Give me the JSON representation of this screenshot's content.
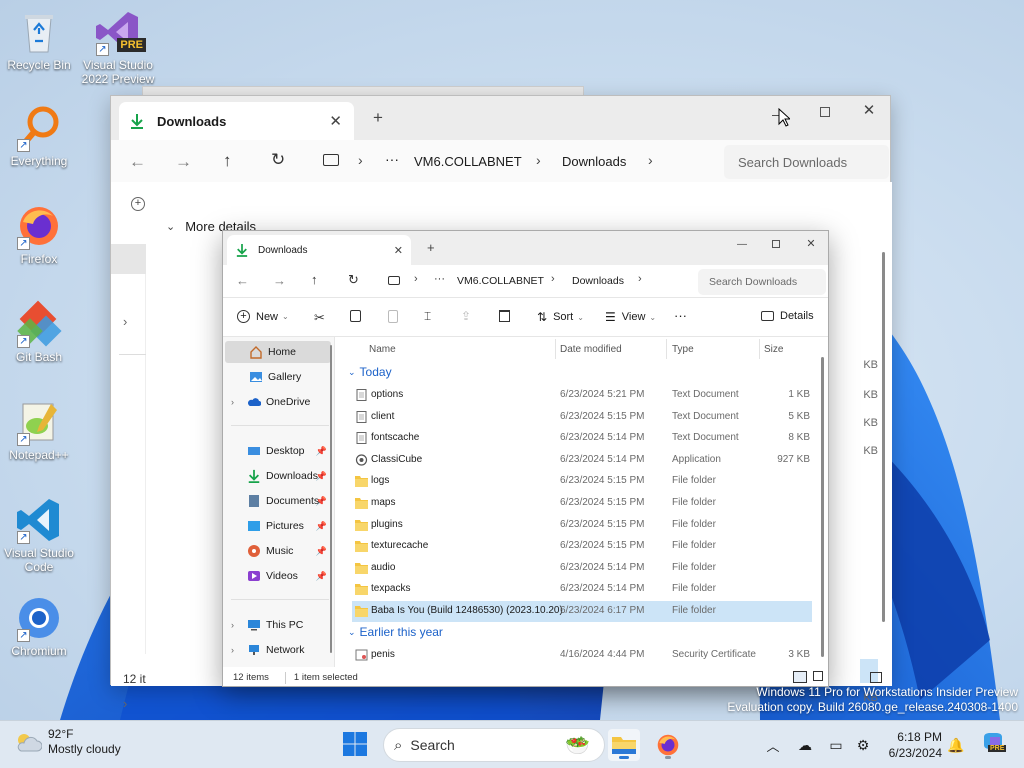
{
  "desktop": {
    "icons": [
      {
        "label": "Recycle Bin"
      },
      {
        "label": "Visual Studio 2022 Preview",
        "badge": "PRE"
      },
      {
        "label": "Everything"
      },
      {
        "label": "Firefox"
      },
      {
        "label": "Git Bash"
      },
      {
        "label": "Notepad++"
      },
      {
        "label": "Visual Studio Code"
      },
      {
        "label": "Chromium"
      }
    ]
  },
  "back_window": {
    "tab_label": "Downloads",
    "new_tab": "+",
    "breadcrumb": {
      "more": "···",
      "items": [
        "VM6.COLLABNET",
        "Downloads"
      ]
    },
    "search_placeholder": "Search Downloads",
    "details_bar_label": "More details",
    "status_count": "12 it",
    "right_sizes": [
      "KB",
      "KB",
      "KB",
      "KB",
      "KB"
    ]
  },
  "front_window": {
    "tab_label": "Downloads",
    "new_tab": "+",
    "breadcrumb": {
      "more": "···",
      "items": [
        "VM6.COLLABNET",
        "Downloads"
      ]
    },
    "search_placeholder": "Search Downloads",
    "toolbar": {
      "new_label": "New",
      "sort_label": "Sort",
      "view_label": "View",
      "more_label": "···",
      "details_label": "Details"
    },
    "sidebar": {
      "top": [
        "Home",
        "Gallery",
        "OneDrive"
      ],
      "quick": [
        "Desktop",
        "Downloads",
        "Documents",
        "Pictures",
        "Music",
        "Videos"
      ],
      "bottom": [
        "This PC",
        "Network"
      ]
    },
    "columns": {
      "name": "Name",
      "date": "Date modified",
      "type": "Type",
      "size": "Size"
    },
    "groups": {
      "today": "Today",
      "earlier": "Earlier this year"
    },
    "files": [
      {
        "name": "options",
        "date": "6/23/2024 5:21 PM",
        "type": "Text Document",
        "size": "1 KB",
        "icon": "document-icon"
      },
      {
        "name": "client",
        "date": "6/23/2024 5:15 PM",
        "type": "Text Document",
        "size": "5 KB",
        "icon": "document-icon"
      },
      {
        "name": "fontscache",
        "date": "6/23/2024 5:14 PM",
        "type": "Text Document",
        "size": "8 KB",
        "icon": "document-icon"
      },
      {
        "name": "ClassiCube",
        "date": "6/23/2024 5:14 PM",
        "type": "Application",
        "size": "927 KB",
        "icon": "application-icon"
      },
      {
        "name": "logs",
        "date": "6/23/2024 5:15 PM",
        "type": "File folder",
        "size": "",
        "icon": "folder-icon"
      },
      {
        "name": "maps",
        "date": "6/23/2024 5:15 PM",
        "type": "File folder",
        "size": "",
        "icon": "folder-icon"
      },
      {
        "name": "plugins",
        "date": "6/23/2024 5:15 PM",
        "type": "File folder",
        "size": "",
        "icon": "folder-icon"
      },
      {
        "name": "texturecache",
        "date": "6/23/2024 5:15 PM",
        "type": "File folder",
        "size": "",
        "icon": "folder-icon"
      },
      {
        "name": "audio",
        "date": "6/23/2024 5:14 PM",
        "type": "File folder",
        "size": "",
        "icon": "folder-icon"
      },
      {
        "name": "texpacks",
        "date": "6/23/2024 5:14 PM",
        "type": "File folder",
        "size": "",
        "icon": "folder-icon"
      },
      {
        "name": "Baba Is You (Build 12486530) (2023.10.20)",
        "date": "6/23/2024 6:17 PM",
        "type": "File folder",
        "size": "",
        "icon": "folder-icon",
        "selected": true
      }
    ],
    "earlier_files": [
      {
        "name": "penis",
        "date": "4/16/2024 4:44 PM",
        "type": "Security Certificate",
        "size": "3 KB",
        "icon": "certificate-icon"
      }
    ],
    "status": {
      "items": "12 items",
      "selected": "1 item selected"
    }
  },
  "watermark": {
    "line1": "Windows 11 Pro for Workstations Insider Preview",
    "line2": "Evaluation copy. Build 26080.ge_release.240308-1400"
  },
  "taskbar": {
    "weather_temp": "92°F",
    "weather_desc": "Mostly cloudy",
    "search_label": "Search",
    "time": "6:18 PM",
    "date": "6/23/2024",
    "copilot_badge": "PRE"
  },
  "colors": {
    "accent": "#1c62c9",
    "folder": "#f4c542",
    "selection": "#cce4f7",
    "taskbar": "#dfe8f2"
  }
}
